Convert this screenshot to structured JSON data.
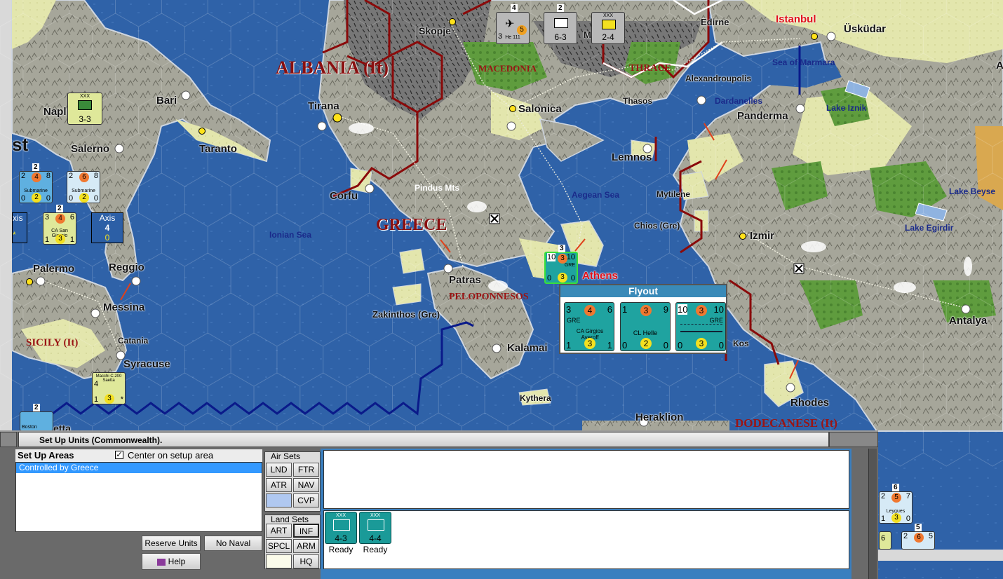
{
  "map": {
    "countries": [
      {
        "name": "ALBANIA (It)",
        "size": 26
      },
      {
        "name": "GREECE",
        "size": 24
      }
    ],
    "regions": [
      "MACEDONIA",
      "THRACE",
      "PELOPONNESOS",
      "SICILY (It)",
      "DODECANESE (It)"
    ],
    "cities": [
      "Skopje",
      "Edirne",
      "Istanbul",
      "Üsküdar",
      "Sea of Marmara",
      "Alexandroupolis",
      "Napl",
      "Bari",
      "Tirana",
      "Salonica",
      "Thasos",
      "Dardanelles",
      "Panderma",
      "Lake Iznik",
      "st",
      "Salerno",
      "Taranto",
      "Lemnos",
      "Corfu",
      "Pindus Mts",
      "Aegean Sea",
      "Mytilene",
      "Lake Beyse",
      "Chios (Gre)",
      "Ionian Sea",
      "Lake Egirdir",
      "Izmir",
      "Palermo",
      "Reggio",
      "Patras",
      "Athens",
      "Messina",
      "Zakinthos (Gre)",
      "Antalya",
      "Catania",
      "Kalamai",
      "Kos",
      "Syracuse",
      "Kythera",
      "Rhodes",
      "Heraklion",
      "A",
      "M",
      "etta"
    ]
  },
  "counters": {
    "top_bomber": {
      "stack": "4",
      "type": "He 111",
      "vals": [
        "3",
        "5"
      ],
      "sub": "3"
    },
    "top_inf": {
      "stack": "2",
      "label": "6-3"
    },
    "top_mech": {
      "label": "2-4",
      "marker": "XXX"
    },
    "naples_corps": {
      "label": "3-3",
      "marker": "XXX",
      "name": "Naples"
    },
    "sub1": {
      "stack": "2",
      "top": [
        "2",
        "4",
        "8"
      ],
      "name": "Submarine",
      "bottom": [
        "0",
        "2",
        "0"
      ]
    },
    "sub2": {
      "top": [
        "2",
        "6",
        "8"
      ],
      "name": "Submarine",
      "bottom": [
        "0",
        "2",
        "0"
      ]
    },
    "ca_sangiorgio": {
      "stack": "2",
      "top": [
        "3",
        "4",
        "6"
      ],
      "name": "CA San Giorgio",
      "bottom": [
        "1",
        "3",
        "1"
      ]
    },
    "axis_box": {
      "title": "Axis",
      "value": "4",
      "sub": "0"
    },
    "left_partial": {
      "title": "xis",
      "sub": "*"
    },
    "macchi": {
      "name": "Macchi C.200 Saetta",
      "vals": [
        "4",
        "1",
        "3"
      ],
      "mark": "*"
    },
    "athens_stack": {
      "stack": "3",
      "top": [
        "10",
        "3",
        "10"
      ],
      "sub": "GRE",
      "bottom": [
        "0",
        "3",
        "0"
      ]
    },
    "bottom_left": {
      "stack": "2",
      "name": "Boston"
    },
    "right_stack_1": {
      "stack": "6",
      "top": [
        "2",
        "5",
        "7"
      ],
      "name": "Leygues",
      "bottom": [
        "1",
        "3",
        "0"
      ]
    },
    "right_stack_2": {
      "stack": "5",
      "top": [
        "2",
        "6",
        "5"
      ],
      "left": "6"
    }
  },
  "flyout": {
    "title": "Flyout",
    "units": [
      {
        "top": [
          "3",
          "4",
          "6"
        ],
        "nation": "GRE",
        "name": "CA Girgios Averoff",
        "bottom": [
          "1",
          "3",
          "1"
        ]
      },
      {
        "top": [
          "1",
          "3",
          "9"
        ],
        "nation": "",
        "name": "CL Helle",
        "bottom": [
          "0",
          "2",
          "0"
        ]
      },
      {
        "top": [
          "10",
          "3",
          "10"
        ],
        "nation": "GRE",
        "name": "",
        "bottom": [
          "0",
          "3",
          "0"
        ]
      }
    ]
  },
  "panel": {
    "title": "Set Up Units (Commonwealth).",
    "setup_areas_label": "Set Up Areas",
    "center_checkbox_label": "Center on setup area",
    "center_checked": true,
    "areas": [
      "Controlled by Greece"
    ],
    "reserve_button": "Reserve Units",
    "no_naval_button": "No Naval",
    "help_button": "Help",
    "air_sets_label": "Air Sets",
    "air_buttons": [
      "LND",
      "FTR",
      "ATR",
      "NAV",
      "",
      "CVP"
    ],
    "land_sets_label": "Land Sets",
    "land_buttons": [
      "ART",
      "INF",
      "SPCL",
      "ARM",
      "",
      "HQ"
    ],
    "units": [
      {
        "label": "4-3",
        "status": "Ready",
        "marker": "XXX"
      },
      {
        "label": "4-4",
        "status": "Ready",
        "marker": "XXX"
      }
    ]
  },
  "colors": {
    "sea": "#2c5fa6",
    "land": "#a8a898",
    "clear": "#dfe3a8",
    "forest": "#5c9a3c",
    "border": "#8a0a0a",
    "teal_unit": "#1fa3a0",
    "panel_bg": "#6a6a6a",
    "selection": "#3399ff"
  }
}
